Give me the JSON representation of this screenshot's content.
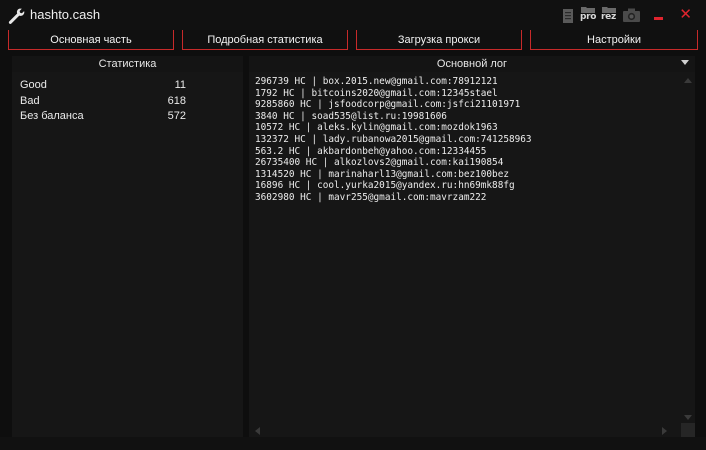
{
  "window": {
    "title": "hashto.cash",
    "icons": [
      "wrench-icon",
      "document-icon",
      "pro-icon",
      "rez-folder-icon",
      "camera-icon",
      "minimize-icon",
      "close-icon"
    ],
    "pro_label": "pro",
    "rez_label": "rez",
    "accent_color": "#c72a2a",
    "close_glyph": "✕"
  },
  "tabs": [
    {
      "label": "Основная часть"
    },
    {
      "label": "Подробная статистика"
    },
    {
      "label": "Загрузка прокси"
    },
    {
      "label": "Настройки"
    }
  ],
  "stats": {
    "header": "Статистика",
    "rows": [
      {
        "name": "Good",
        "value": "11"
      },
      {
        "name": "Bad",
        "value": "618"
      },
      {
        "name": "Без баланса",
        "value": "572"
      }
    ]
  },
  "log": {
    "header": "Основной лог",
    "lines": [
      "296739 HC | box.2015.new@gmail.com:78912121",
      "1792 HC | bitcoins2020@gmail.com:12345stael",
      "9285860 HC | jsfoodcorp@gmail.com:jsfci21101971",
      "3840 HC | soad535@list.ru:19981606",
      "10572 HC | aleks.kylin@gmail.com:mozdok1963",
      "132372 HC | lady.rubanowa2015@gmail.com:741258963",
      "563.2 HC | akbardonbeh@yahoo.com:12334455",
      "26735400 HC | alkozlovs2@gmail.com:kai190854",
      "1314520 HC | marinaharl13@gmail.com:bez100bez",
      "16896 HC | cool.yurka2015@yandex.ru:hn69mk88fg",
      "3602980 HC | mavr255@gmail.com:mavrzam222"
    ]
  }
}
